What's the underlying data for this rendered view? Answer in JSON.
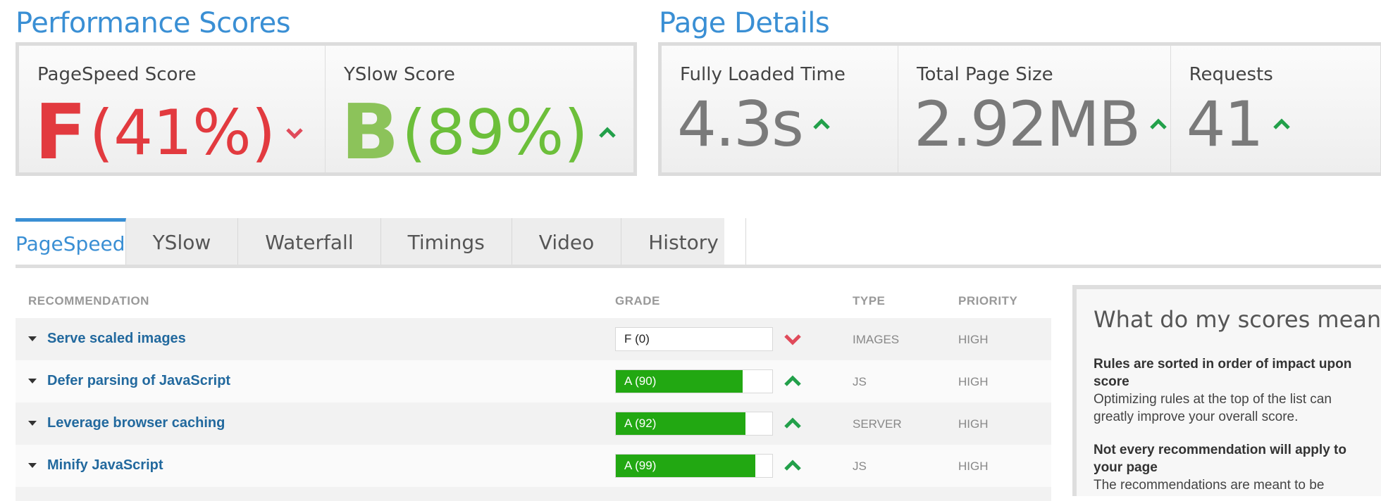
{
  "performance": {
    "title": "Performance Scores",
    "pagespeed": {
      "label": "PageSpeed Score",
      "grade": "F",
      "percent": "(41%)",
      "trend": "down",
      "color": "#e23a3f"
    },
    "yslow": {
      "label": "YSlow Score",
      "grade": "B",
      "percent": "(89%)",
      "trend": "up",
      "color": "#7dc141"
    }
  },
  "details": {
    "title": "Page Details",
    "items": [
      {
        "label": "Fully Loaded Time",
        "value": "4.3s",
        "trend": "up"
      },
      {
        "label": "Total Page Size",
        "value": "2.92MB",
        "trend": "up"
      },
      {
        "label": "Requests",
        "value": "41",
        "trend": "up"
      }
    ]
  },
  "tabs": [
    "PageSpeed",
    "YSlow",
    "Waterfall",
    "Timings",
    "Video",
    "History"
  ],
  "active_tab": "PageSpeed",
  "table": {
    "headers": {
      "recommendation": "RECOMMENDATION",
      "grade": "GRADE",
      "type": "TYPE",
      "priority": "PRIORITY"
    },
    "rows": [
      {
        "recommendation": "Serve scaled images",
        "grade": "F (0)",
        "score": 0,
        "trend": "down",
        "type": "IMAGES",
        "priority": "HIGH"
      },
      {
        "recommendation": "Defer parsing of JavaScript",
        "grade": "A (90)",
        "score": 90,
        "trend": "up",
        "type": "JS",
        "priority": "HIGH"
      },
      {
        "recommendation": "Leverage browser caching",
        "grade": "A (92)",
        "score": 92,
        "trend": "up",
        "type": "SERVER",
        "priority": "HIGH"
      },
      {
        "recommendation": "Minify JavaScript",
        "grade": "A (99)",
        "score": 99,
        "trend": "up",
        "type": "JS",
        "priority": "HIGH"
      }
    ]
  },
  "sidebar": {
    "title": "What do my scores mean?",
    "blocks": [
      {
        "heading": "Rules are sorted in order of impact upon score",
        "text": "Optimizing rules at the top of the list can greatly improve your overall score."
      },
      {
        "heading": "Not every recommendation will apply to your page",
        "text": "The recommendations are meant to be"
      }
    ]
  },
  "colors": {
    "accent": "#3a8fd4",
    "good": "#22a812",
    "bad": "#e23a3f",
    "link": "#22699e"
  }
}
